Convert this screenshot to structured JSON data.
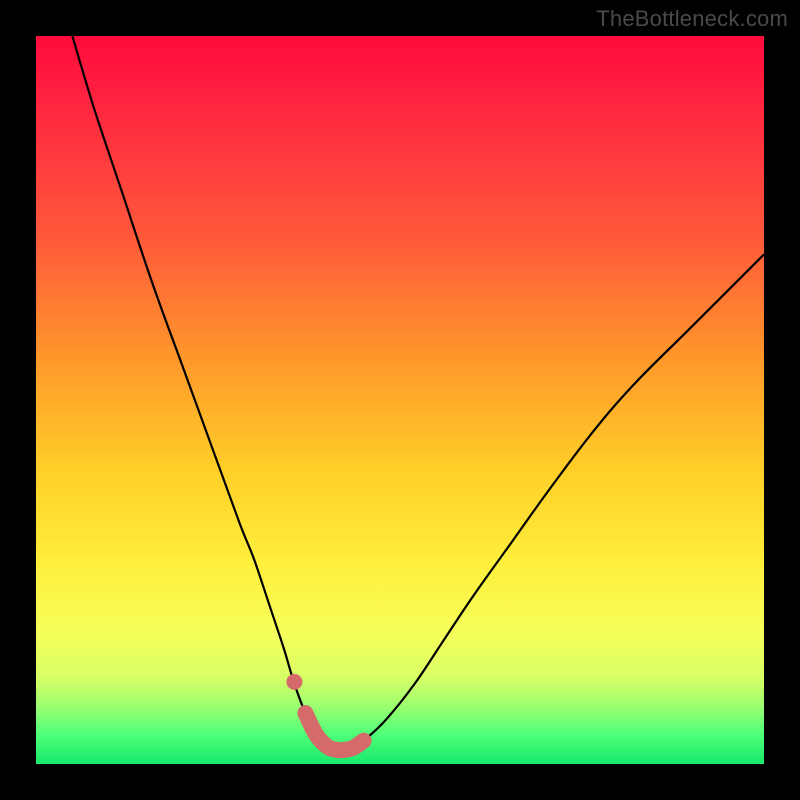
{
  "watermark": "TheBottleneck.com",
  "colors": {
    "accent": "#d56a6a",
    "curve": "#000000",
    "frame": "#000000"
  },
  "chart_data": {
    "type": "line",
    "title": "",
    "xlabel": "",
    "ylabel": "",
    "xlim": [
      0,
      100
    ],
    "ylim": [
      0,
      100
    ],
    "grid": false,
    "legend": false,
    "series": [
      {
        "name": "bottleneck-curve",
        "x": [
          5,
          8,
          12,
          16,
          20,
          24,
          28,
          30,
          32,
          34,
          35.5,
          37,
          38.5,
          40,
          41,
          42,
          43.5,
          45,
          48,
          52,
          56,
          60,
          65,
          70,
          76,
          82,
          90,
          100
        ],
        "y": [
          100,
          90,
          78,
          66,
          55,
          44,
          33,
          28,
          22,
          16,
          11,
          7,
          4,
          2.4,
          2.0,
          1.9,
          2.2,
          3.2,
          6,
          11,
          17,
          23,
          30,
          37,
          45,
          52,
          60,
          70
        ]
      }
    ],
    "accent_region": {
      "name": "optimal-range",
      "x": [
        34,
        35.5,
        37,
        38.5,
        40,
        41,
        42,
        43.5,
        45
      ],
      "y": [
        16,
        11,
        7,
        4,
        2.4,
        2.0,
        1.9,
        2.2,
        3.2
      ]
    },
    "background_gradient": [
      "#ff0a3c",
      "#ff9a2a",
      "#ffee3a",
      "#18e86a"
    ]
  }
}
